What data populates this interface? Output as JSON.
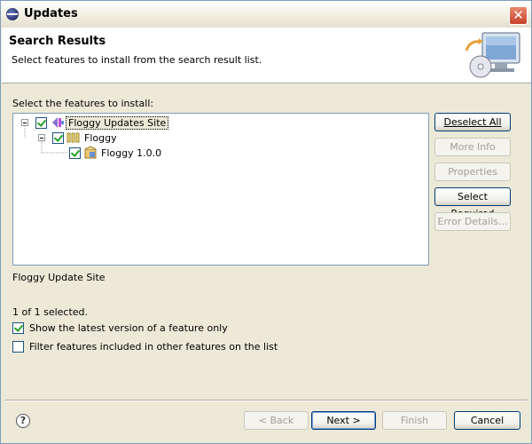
{
  "window": {
    "title": "Updates"
  },
  "header": {
    "title": "Search Results",
    "description": "Select features to install from the search result list."
  },
  "features_label": "Select the features to install:",
  "tree": {
    "items": [
      {
        "label": "Floggy Updates Site",
        "checked": true,
        "level": 0,
        "expanded": true,
        "selected": true,
        "icon": "update-site-icon"
      },
      {
        "label": "Floggy",
        "checked": true,
        "level": 1,
        "expanded": true,
        "icon": "category-icon"
      },
      {
        "label": "Floggy 1.0.0",
        "checked": true,
        "level": 2,
        "icon": "feature-icon"
      }
    ]
  },
  "side_buttons": {
    "deselect_all": "Deselect All",
    "more_info": "More Info",
    "properties": "Properties",
    "select_required": "Select Required",
    "error_details": "Error Details..."
  },
  "description_text": "Floggy Update Site",
  "selected_count": "1 of 1 selected.",
  "options": {
    "show_latest": {
      "label": "Show the latest version of a feature only",
      "checked": true
    },
    "filter_included": {
      "label": "Filter features included in other features on the list",
      "checked": false
    }
  },
  "footer": {
    "back": "< Back",
    "next": "Next >",
    "finish": "Finish",
    "cancel": "Cancel"
  },
  "colors": {
    "check_green": "#21a121",
    "button_border": "#003c74",
    "disabled_text": "#a19f95"
  }
}
